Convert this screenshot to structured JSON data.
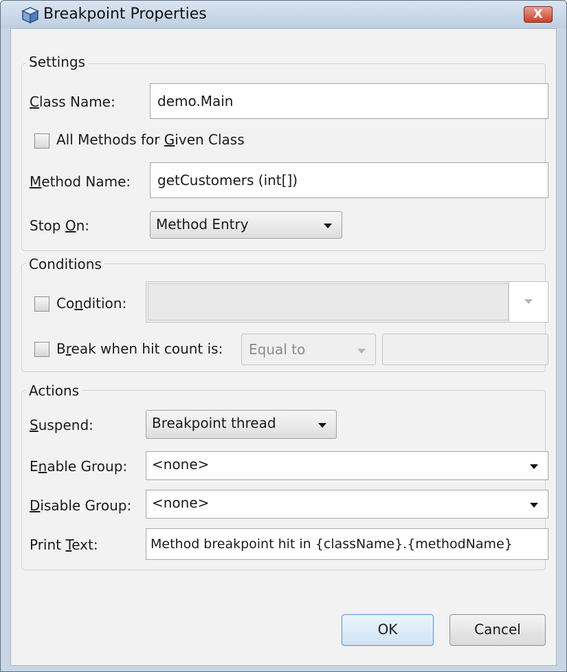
{
  "window": {
    "title": "Breakpoint Properties",
    "close_glyph": "X",
    "icon": "cube-icon"
  },
  "settings": {
    "legend": "Settings",
    "class_name": {
      "pre": "",
      "key": "C",
      "post": "lass Name:",
      "value": "demo.Main"
    },
    "all_methods": {
      "pre": "All Methods for ",
      "key": "G",
      "post": "iven Class",
      "checked": false
    },
    "method_name": {
      "pre": "",
      "key": "M",
      "post": "ethod Name:",
      "value": "getCustomers (int[])"
    },
    "stop_on": {
      "pre": "Stop ",
      "key": "O",
      "post": "n:",
      "value": "Method Entry"
    }
  },
  "conditions": {
    "legend": "Conditions",
    "condition": {
      "pre": "Co",
      "key": "n",
      "post": "dition:",
      "checked": false,
      "value": ""
    },
    "hit_count": {
      "pre": "B",
      "key": "r",
      "post": "eak when hit count is:",
      "checked": false,
      "operator": "Equal to",
      "value": ""
    }
  },
  "actions": {
    "legend": "Actions",
    "suspend": {
      "pre": "",
      "key": "S",
      "post": "uspend:",
      "value": "Breakpoint thread"
    },
    "enable_group": {
      "pre": "E",
      "key": "n",
      "post": "able Group:",
      "value": "<none>"
    },
    "disable_group": {
      "pre": "",
      "key": "D",
      "post": "isable Group:",
      "value": "<none>"
    },
    "print_text": {
      "pre": "Print ",
      "key": "T",
      "post": "ext:",
      "value": "Method breakpoint hit in {className}.{methodName}"
    }
  },
  "buttons": {
    "ok": "OK",
    "cancel": "Cancel"
  }
}
